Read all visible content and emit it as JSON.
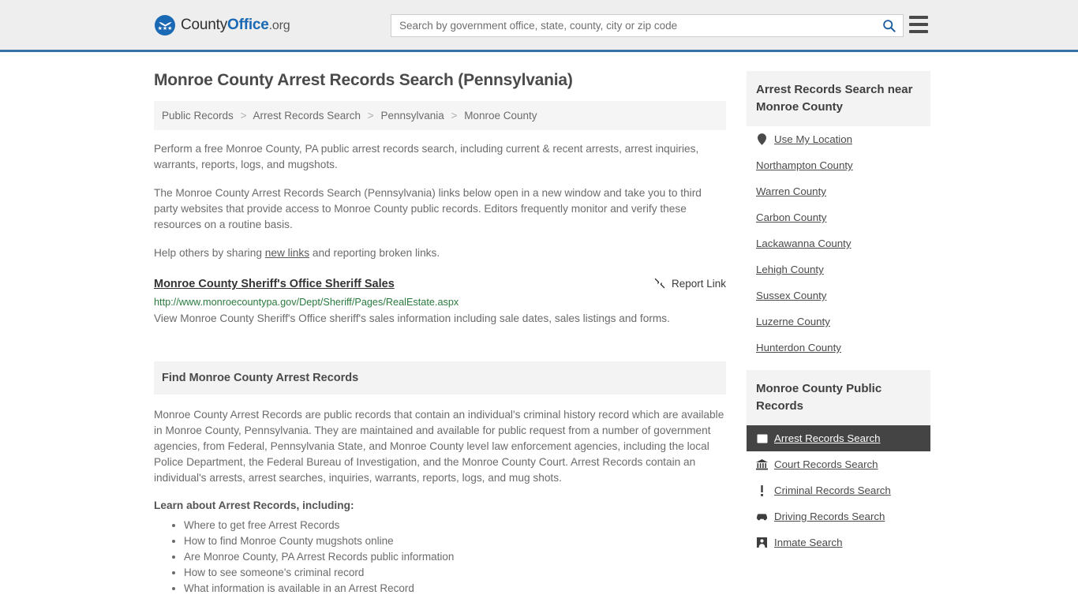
{
  "header": {
    "logo": {
      "part1": "County",
      "part2": "Office",
      "part3": ".org",
      "icon": "eagle-badge-icon"
    },
    "search": {
      "placeholder": "Search by government office, state, county, city or zip code",
      "value": "",
      "icon": "search-icon"
    },
    "menu_icon": "hamburger-menu-icon",
    "accent_color": "#3572a5",
    "background_color": "#eeeeee"
  },
  "page": {
    "title": "Monroe County Arrest Records Search (Pennsylvania)",
    "breadcrumb": [
      "Public Records",
      "Arrest Records Search",
      "Pennsylvania",
      "Monroe County"
    ],
    "breadcrumb_separator": ">",
    "paragraphs": [
      "Perform a free Monroe County, PA public arrest records search, including current & recent arrests, arrest inquiries, warrants, reports, logs, and mugshots.",
      "The Monroe County Arrest Records Search (Pennsylvania) links below open in a new window and take you to third party websites that provide access to Monroe County public records. Editors frequently monitor and verify these resources on a routine basis."
    ],
    "share_prefix": "Help others by sharing ",
    "share_link": "new links",
    "share_suffix": " and reporting broken links."
  },
  "result": {
    "title": "Monroe County Sheriff's Office Sheriff Sales",
    "url": "http://www.monroecountypa.gov/Dept/Sheriff/Pages/RealEstate.aspx",
    "description": "View Monroe County Sheriff's Office sheriff's sales information including sale dates, sales listings and forms.",
    "report_label": "Report Link",
    "report_icon": "broken-link-icon",
    "url_color": "#2a7a3e"
  },
  "find_section": {
    "heading": "Find Monroe County Arrest Records",
    "body": "Monroe County Arrest Records are public records that contain an individual's criminal history record which are available in Monroe County, Pennsylvania. They are maintained and available for public request from a number of government agencies, from Federal, Pennsylvania State, and Monroe County level law enforcement agencies, including the local Police Department, the Federal Bureau of Investigation, and the Monroe County Court. Arrest Records contain an individual's arrests, arrest searches, inquiries, warrants, reports, logs, and mug shots.",
    "learn_heading": "Learn about Arrest Records, including:",
    "learn_items": [
      "Where to get free Arrest Records",
      "How to find Monroe County mugshots online",
      "Are Monroe County, PA Arrest Records public information",
      "How to see someone's criminal record",
      "What information is available in an Arrest Record"
    ]
  },
  "sidebar": {
    "nearby": {
      "heading": "Arrest Records Search near Monroe County",
      "items": [
        {
          "label": "Use My Location",
          "icon": "map-pin-icon"
        },
        {
          "label": "Northampton County",
          "icon": ""
        },
        {
          "label": "Warren County",
          "icon": ""
        },
        {
          "label": "Carbon County",
          "icon": ""
        },
        {
          "label": "Lackawanna County",
          "icon": ""
        },
        {
          "label": "Lehigh County",
          "icon": ""
        },
        {
          "label": "Sussex County",
          "icon": ""
        },
        {
          "label": "Luzerne County",
          "icon": ""
        },
        {
          "label": "Hunterdon County",
          "icon": ""
        }
      ]
    },
    "public_records": {
      "heading": "Monroe County Public Records",
      "items": [
        {
          "label": "Arrest Records Search",
          "icon": "id-card-icon",
          "active": true
        },
        {
          "label": "Court Records Search",
          "icon": "courthouse-icon",
          "active": false
        },
        {
          "label": "Criminal Records Search",
          "icon": "exclamation-icon",
          "active": false
        },
        {
          "label": "Driving Records Search",
          "icon": "car-icon",
          "active": false
        },
        {
          "label": "Inmate Search",
          "icon": "inmate-icon",
          "active": false
        }
      ],
      "active_background": "#444444"
    }
  }
}
